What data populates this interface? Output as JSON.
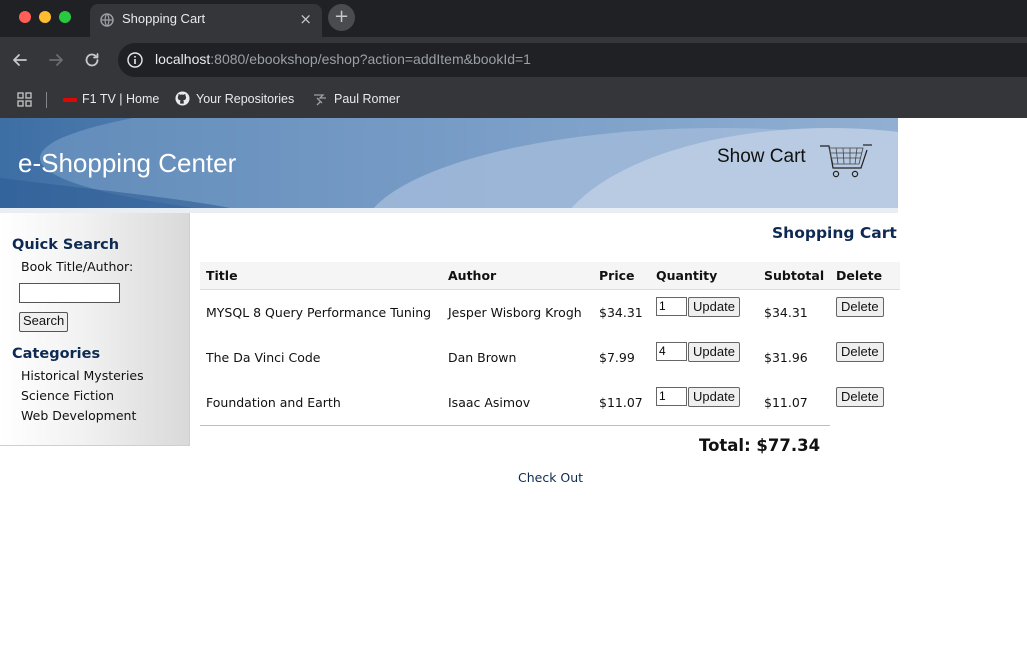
{
  "browser": {
    "tab_title": "Shopping Cart",
    "tab_close": "×",
    "new_tab": "+",
    "url_host": "localhost",
    "url_rest": ":8080/ebookshop/eshop?action=addItem&bookId=1",
    "bookmarks": [
      {
        "label": "F1 TV | Home"
      },
      {
        "label": "Your Repositories"
      },
      {
        "label": "Paul Romer"
      }
    ]
  },
  "banner": {
    "title": "e-Shopping Center",
    "show_cart": "Show Cart"
  },
  "sidebar": {
    "quick_search_heading": "Quick Search",
    "search_label": "Book Title/Author:",
    "search_value": "",
    "search_button": "Search",
    "categories_heading": "Categories",
    "categories": [
      "Historical Mysteries",
      "Science Fiction",
      "Web Development"
    ]
  },
  "cart": {
    "heading": "Shopping Cart",
    "columns": [
      "Title",
      "Author",
      "Price",
      "Quantity",
      "Subtotal",
      "Delete"
    ],
    "rows": [
      {
        "title": "MYSQL 8 Query Performance Tuning",
        "author": "Jesper Wisborg Krogh",
        "price": "$34.31",
        "quantity": "1",
        "subtotal": "$34.31"
      },
      {
        "title": "The Da Vinci Code",
        "author": "Dan Brown",
        "price": "$7.99",
        "quantity": "4",
        "subtotal": "$31.96"
      },
      {
        "title": "Foundation and Earth",
        "author": "Isaac Asimov",
        "price": "$11.07",
        "quantity": "1",
        "subtotal": "$11.07"
      }
    ],
    "update_label": "Update",
    "delete_label": "Delete",
    "total": "Total: $77.34",
    "checkout": "Check Out"
  }
}
